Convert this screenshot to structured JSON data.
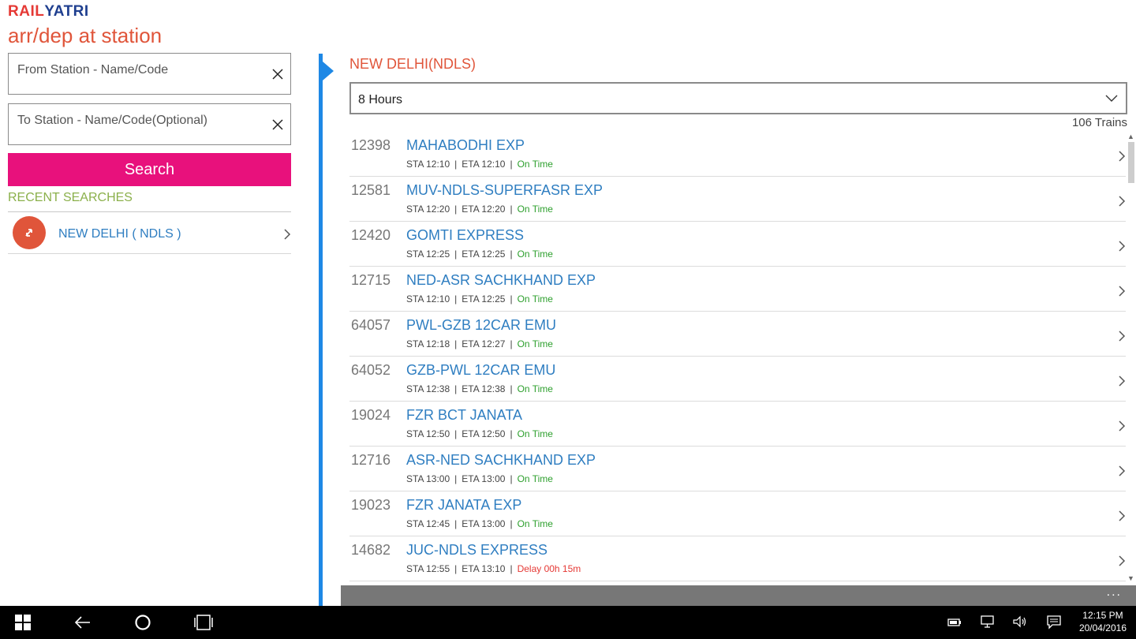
{
  "app": {
    "logo_rail": "RAIL",
    "logo_yatri": "YATRI",
    "page_title": "arr/dep at station"
  },
  "left": {
    "from_placeholder": "From Station - Name/Code",
    "to_placeholder": "To Station - Name/Code(Optional)",
    "search_label": "Search",
    "recent_label": "RECENT SEARCHES",
    "recent_items": [
      {
        "label": "NEW DELHI ( NDLS )"
      }
    ]
  },
  "right": {
    "station_title": "NEW DELHI(NDLS)",
    "hours_value": "8 Hours",
    "train_count": "106 Trains",
    "trains": [
      {
        "number": "12398",
        "name": "MAHABODHI EXP",
        "sta": "STA 12:10",
        "eta": "ETA 12:10",
        "status": "On Time",
        "status_type": "ok"
      },
      {
        "number": "12581",
        "name": "MUV-NDLS-SUPERFASR EXP",
        "sta": "STA 12:20",
        "eta": "ETA 12:20",
        "status": "On Time",
        "status_type": "ok"
      },
      {
        "number": "12420",
        "name": "GOMTI EXPRESS",
        "sta": "STA 12:25",
        "eta": "ETA 12:25",
        "status": "On Time",
        "status_type": "ok"
      },
      {
        "number": "12715",
        "name": "NED-ASR SACHKHAND EXP",
        "sta": "STA 12:10",
        "eta": "ETA 12:25",
        "status": "On Time",
        "status_type": "ok"
      },
      {
        "number": "64057",
        "name": "PWL-GZB 12CAR EMU",
        "sta": "STA 12:18",
        "eta": "ETA 12:27",
        "status": "On Time",
        "status_type": "ok"
      },
      {
        "number": "64052",
        "name": "GZB-PWL 12CAR EMU",
        "sta": "STA 12:38",
        "eta": "ETA 12:38",
        "status": "On Time",
        "status_type": "ok"
      },
      {
        "number": "19024",
        "name": "FZR BCT JANATA",
        "sta": "STA 12:50",
        "eta": "ETA 12:50",
        "status": "On Time",
        "status_type": "ok"
      },
      {
        "number": "12716",
        "name": "ASR-NED SACHKHAND EXP",
        "sta": "STA 13:00",
        "eta": "ETA 13:00",
        "status": "On Time",
        "status_type": "ok"
      },
      {
        "number": "19023",
        "name": "FZR JANATA EXP",
        "sta": "STA 12:45",
        "eta": "ETA 13:00",
        "status": "On Time",
        "status_type": "ok"
      },
      {
        "number": "14682",
        "name": "JUC-NDLS EXPRESS",
        "sta": "STA 12:55",
        "eta": "ETA 13:10",
        "status": "Delay 00h 15m",
        "status_type": "late"
      }
    ],
    "more_label": "..."
  },
  "taskbar": {
    "time": "12:15 PM",
    "date": "20/04/2016"
  },
  "colors": {
    "accent_pink": "#e8117c",
    "accent_blue": "#1e88e5",
    "title_orange": "#e0553a",
    "link_blue": "#2f7ec1",
    "ok_green": "#2ea02e",
    "late_red": "#e53935"
  }
}
